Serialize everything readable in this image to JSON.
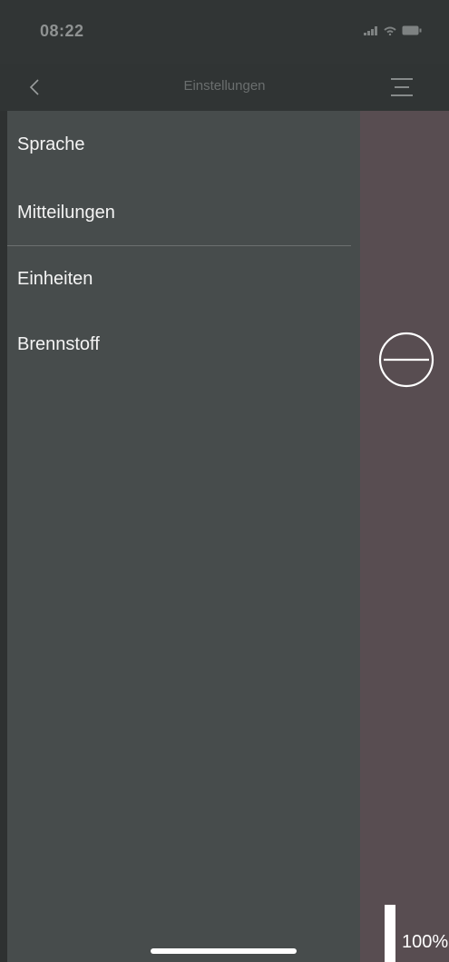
{
  "status_bar": {
    "time": "08:22",
    "icons": [
      "signal-icon",
      "wifi-icon",
      "battery-icon"
    ]
  },
  "nav": {
    "title": "Einstellungen",
    "back_icon": "chevron-left-icon",
    "menu_icon": "hamburger-menu-icon"
  },
  "menu": {
    "items": [
      {
        "label": "Sprache"
      },
      {
        "label": "Mitteilungen"
      },
      {
        "label": "Einheiten"
      },
      {
        "label": "Brennstoff"
      }
    ]
  },
  "side_panel": {
    "minus_icon": "minus-circle-icon",
    "level_value": "100%",
    "level_fraction": 1.0
  },
  "colors": {
    "drawer_bg": "#474c4c",
    "side_panel_bg": "#584d51",
    "header_bg": "#313535"
  }
}
